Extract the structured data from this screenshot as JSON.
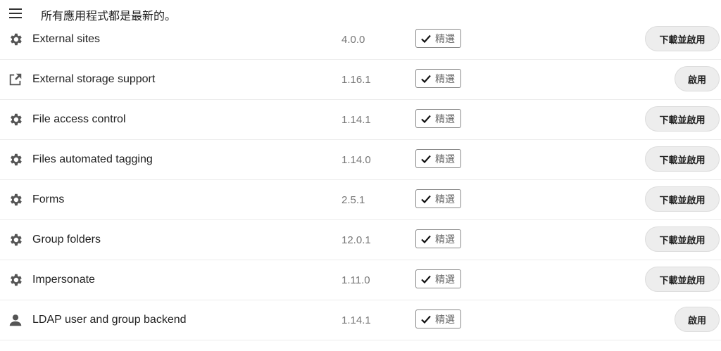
{
  "header": {
    "status": "所有應用程式都是最新的。"
  },
  "apps": [
    {
      "icon": "gear-icon",
      "name": "External sites",
      "version": "4.0.0",
      "badge": "精選",
      "action": "下載並啟用"
    },
    {
      "icon": "external-link-icon",
      "name": "External storage support",
      "version": "1.16.1",
      "badge": "精選",
      "action": "啟用"
    },
    {
      "icon": "gear-icon",
      "name": "File access control",
      "version": "1.14.1",
      "badge": "精選",
      "action": "下載並啟用"
    },
    {
      "icon": "gear-icon",
      "name": "Files automated tagging",
      "version": "1.14.0",
      "badge": "精選",
      "action": "下載並啟用"
    },
    {
      "icon": "gear-icon",
      "name": "Forms",
      "version": "2.5.1",
      "badge": "精選",
      "action": "下載並啟用"
    },
    {
      "icon": "gear-icon",
      "name": "Group folders",
      "version": "12.0.1",
      "badge": "精選",
      "action": "下載並啟用"
    },
    {
      "icon": "gear-icon",
      "name": "Impersonate",
      "version": "1.11.0",
      "badge": "精選",
      "action": "下載並啟用"
    },
    {
      "icon": "user-icon",
      "name": "LDAP user and group backend",
      "version": "1.14.1",
      "badge": "精選",
      "action": "啟用"
    }
  ],
  "colors": {
    "icon": "#555555",
    "button_bg": "#ededed",
    "divider": "#ececec"
  }
}
